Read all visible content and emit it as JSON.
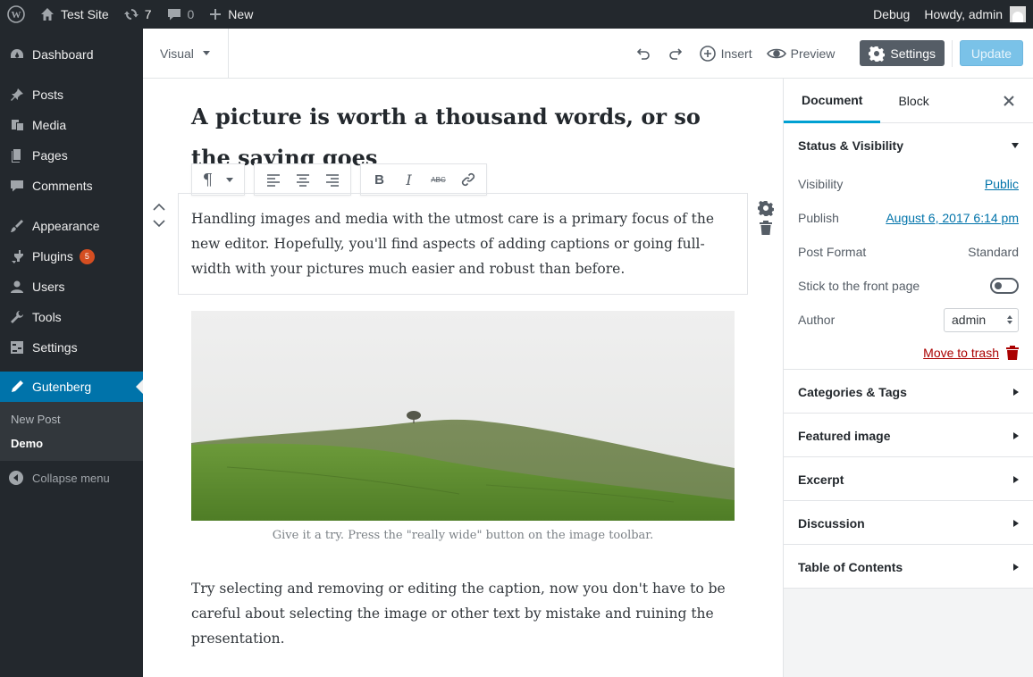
{
  "adminbar": {
    "site_name": "Test Site",
    "updates_count": "7",
    "comments_count": "0",
    "new_label": "New",
    "debug_label": "Debug",
    "howdy_label": "Howdy, admin"
  },
  "sidebar": {
    "items": [
      {
        "label": "Dashboard",
        "icon": "dashboard-icon"
      },
      {
        "label": "Posts",
        "icon": "pin-icon"
      },
      {
        "label": "Media",
        "icon": "media-icon"
      },
      {
        "label": "Pages",
        "icon": "pages-icon"
      },
      {
        "label": "Comments",
        "icon": "comments-icon"
      },
      {
        "label": "Appearance",
        "icon": "brush-icon"
      },
      {
        "label": "Plugins",
        "icon": "plugin-icon",
        "badge": "5"
      },
      {
        "label": "Users",
        "icon": "users-icon"
      },
      {
        "label": "Tools",
        "icon": "wrench-icon"
      },
      {
        "label": "Settings",
        "icon": "settings-icon"
      },
      {
        "label": "Gutenberg",
        "icon": "pencil-icon"
      }
    ],
    "submenu": [
      "New Post",
      "Demo"
    ],
    "collapse_label": "Collapse menu"
  },
  "header": {
    "mode_label": "Visual",
    "insert_label": "Insert",
    "preview_label": "Preview",
    "settings_label": "Settings",
    "update_label": "Update"
  },
  "editor": {
    "title": "A picture is worth a thousand words, or so the saying goes",
    "paragraph1": "Handling images and media with the utmost care is a primary focus of the new editor. Hopefully, you'll find aspects of adding captions or going full-width with your pictures much easier and robust than before.",
    "caption": "Give it a try. Press the \"really wide\" button on the image toolbar.",
    "paragraph2": "Try selecting and removing or editing the caption, now you don't have to be careful about selecting the image or other text by mistake and ruining the presentation.",
    "toolbar": {
      "paragraph_glyph": "¶",
      "bold": "B",
      "italic": "I",
      "strike": "ABC"
    }
  },
  "panel": {
    "tabs": [
      "Document",
      "Block"
    ],
    "status": {
      "title": "Status & Visibility",
      "visibility_label": "Visibility",
      "visibility_value": "Public",
      "publish_label": "Publish",
      "publish_value": "August 6, 2017 6:14 pm",
      "format_label": "Post Format",
      "format_value": "Standard",
      "sticky_label": "Stick to the front page",
      "author_label": "Author",
      "author_value": "admin",
      "trash_label": "Move to trash"
    },
    "sections": [
      "Categories & Tags",
      "Featured image",
      "Excerpt",
      "Discussion",
      "Table of Contents"
    ]
  },
  "colors": {
    "admin_dark": "#23282d",
    "accent_blue": "#0073aa",
    "update_button": "#7ac2e8",
    "tab_underline": "#00a0d2",
    "trash_red": "#aa0000"
  }
}
